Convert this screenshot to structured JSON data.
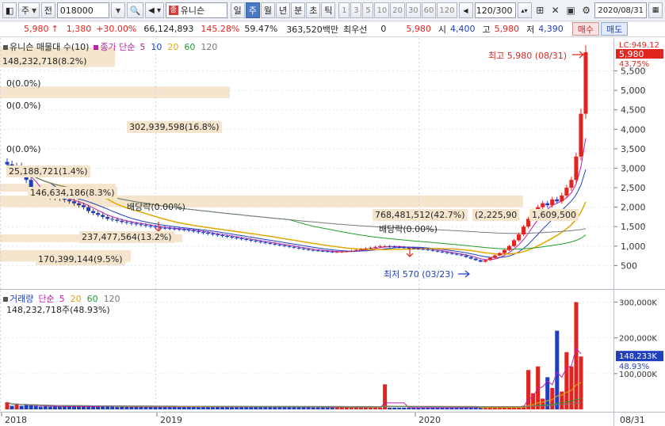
{
  "toolbar": {
    "type_select": "주",
    "all_label": "전",
    "code": "018000",
    "stock_name": "유니슨",
    "stock_badge": "종",
    "period_tabs": [
      "일",
      "주",
      "월",
      "년",
      "분",
      "초",
      "틱"
    ],
    "active_period": "주",
    "number_buttons": [
      "1",
      "3",
      "5",
      "10",
      "20",
      "30",
      "60",
      "120"
    ],
    "count_display": "120/300",
    "date": "2020/08/31"
  },
  "quote": {
    "price": "5,980",
    "arrow": "↑",
    "change": "1,380",
    "change_pct": "+30.00%",
    "volume": "66,124,893",
    "vol_ratio": "145.28%",
    "turnover": "59.47%",
    "amount": "363,520백만",
    "pref_label": "최우선",
    "pref_value": "0",
    "pref_price": "5,980",
    "open_label": "시",
    "open": "4,400",
    "high_label": "고",
    "high": "5,980",
    "low_label": "저",
    "low": "4,390",
    "buy_label": "매수",
    "sell_label": "매도"
  },
  "price_panel": {
    "legend_title": "유니슨 매물대 수(10)",
    "ma_title": "종가 단순",
    "ma_periods": [
      "5",
      "10",
      "20",
      "60",
      "120"
    ],
    "ma_colors": [
      "#c01fa8",
      "#1f3fbf",
      "#e0a800",
      "#1f9e2a",
      "#7a7a7a"
    ],
    "annotations": [
      "148,232,718(8.2%)",
      "0(0.0%)",
      "0(0.0%)",
      "302,939,598(16.8%)",
      "0(0.0%)",
      "25,188,721(1.4%)",
      "146,634,186(8.3%)",
      "배당락(0.00%)",
      "237,477,564(13.2%)",
      "170,399,144(9.5%)",
      "768,481,512(42.7%)",
      "(2,225,90",
      "1,609,500",
      "배당락(0.00%)"
    ],
    "high_label": "최고 5,980 (08/31)",
    "low_label": "최저 570 (03/23)",
    "axis_tag_top": "LC:949.12",
    "axis_tag_price": "5,980",
    "axis_tag_pct": "43.75%",
    "axis_ticks": [
      "5,500",
      "5,000",
      "4,500",
      "4,000",
      "3,500",
      "3,000",
      "2,500",
      "2,000",
      "1,500",
      "1,000",
      "500"
    ]
  },
  "volume_panel": {
    "title": "거래량",
    "ma_title": "단순",
    "ma_periods": [
      "5",
      "20",
      "60",
      "120"
    ],
    "ma_colors": [
      "#c01fa8",
      "#e0a800",
      "#1f9e2a",
      "#7a7a7a"
    ],
    "subtitle": "148,232,718주(48.93%)",
    "axis_ticks": [
      "300,000K",
      "200,000K",
      "100,000K"
    ],
    "axis_tag": "148,233K",
    "axis_tag_pct": "48.93%"
  },
  "date_axis": {
    "labels": [
      "2018",
      "2019",
      "2020"
    ],
    "right_label": "08/31"
  },
  "chart_data": {
    "type": "candlestick",
    "series": [
      {
        "name": "주가",
        "values": [
          3100,
          2950,
          3050,
          2850,
          2700,
          2400,
          2320,
          2300,
          2280,
          2260,
          2240,
          2220,
          2190,
          2150,
          2100,
          2050,
          2000,
          1900,
          1850,
          1800,
          1750,
          1700,
          1680,
          1650,
          1620,
          1600,
          1580,
          1560,
          1540,
          1520,
          1500,
          1480,
          1470,
          1460,
          1450,
          1440,
          1430,
          1420,
          1400,
          1380,
          1360,
          1340,
          1320,
          1300,
          1280,
          1260,
          1240,
          1220,
          1200,
          1180,
          1160,
          1140,
          1120,
          1100,
          1080,
          1060,
          1040,
          1020,
          1000,
          980,
          960,
          940,
          920,
          900,
          890,
          880,
          870,
          860,
          850,
          850,
          860,
          870,
          880,
          900,
          920,
          940,
          960,
          980,
          1000,
          1000,
          990,
          980,
          970,
          960,
          950,
          940,
          930,
          920,
          900,
          880,
          860,
          840,
          820,
          800,
          780,
          760,
          720,
          680,
          640,
          600,
          640,
          700,
          760,
          820,
          900,
          1000,
          1150,
          1300,
          1500,
          1700,
          1900,
          2000,
          2100,
          2050,
          2200,
          2150,
          2300,
          2500,
          2700,
          3300,
          4400,
          5980
        ]
      }
    ],
    "volume": [
      20,
      10,
      15,
      10,
      12,
      12,
      10,
      8,
      9,
      8,
      9,
      8,
      9,
      8,
      9,
      8,
      9,
      8,
      9,
      8,
      10,
      9,
      8,
      7,
      8,
      7,
      8,
      7,
      8,
      7,
      8,
      7,
      8,
      7,
      8,
      7,
      8,
      7,
      8,
      7,
      8,
      7,
      8,
      7,
      8,
      7,
      8,
      7,
      8,
      7,
      8,
      7,
      8,
      7,
      8,
      7,
      8,
      7,
      8,
      7,
      8,
      7,
      8,
      7,
      6,
      6,
      6,
      6,
      6,
      6,
      6,
      6,
      5,
      5,
      5,
      5,
      5,
      5,
      5,
      70,
      5,
      5,
      5,
      5,
      5,
      5,
      5,
      5,
      5,
      5,
      5,
      5,
      5,
      5,
      5,
      5,
      5,
      5,
      5,
      5,
      6,
      6,
      6,
      6,
      6,
      6,
      6,
      8,
      10,
      110,
      45,
      120,
      30,
      90,
      60,
      220,
      50,
      160,
      120,
      300,
      148
    ]
  }
}
